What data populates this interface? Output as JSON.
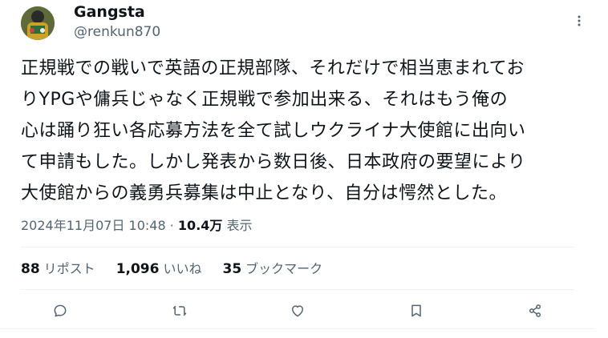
{
  "tweet": {
    "author_name": "Gangsta",
    "author_handle": "@renkun870",
    "lines": [
      "正規戦での戦いで英語の正規部隊、それだけで相当恵まれてお",
      "りYPGや傭兵じゃなく正規戦で参加出来る、それはもう俺の",
      "心は踊り狂い各応募方法を全て試しウクライナ大使館に出向い",
      "て申請もした。しかし発表から数日後、日本政府の要望により",
      "大使館からの義勇兵募集は中止となり、自分は愕然とした。"
    ],
    "timestamp": "2024年11月07日 10:48",
    "separator": "·",
    "views_count": "10.4万",
    "views_label": "表示"
  },
  "stats": {
    "reposts_count": "88",
    "reposts_label": "リポスト",
    "likes_count": "1,096",
    "likes_label": "いいね",
    "bookmarks_count": "35",
    "bookmarks_label": "ブックマーク"
  },
  "icons": {
    "more": "more-vertical-icon",
    "reply": "reply-icon",
    "repost": "repost-icon",
    "like": "heart-icon",
    "bookmark": "bookmark-icon",
    "share": "share-icon"
  },
  "colors": {
    "text": "#0f1419",
    "secondary": "#536471",
    "divider": "#eff3f4"
  }
}
